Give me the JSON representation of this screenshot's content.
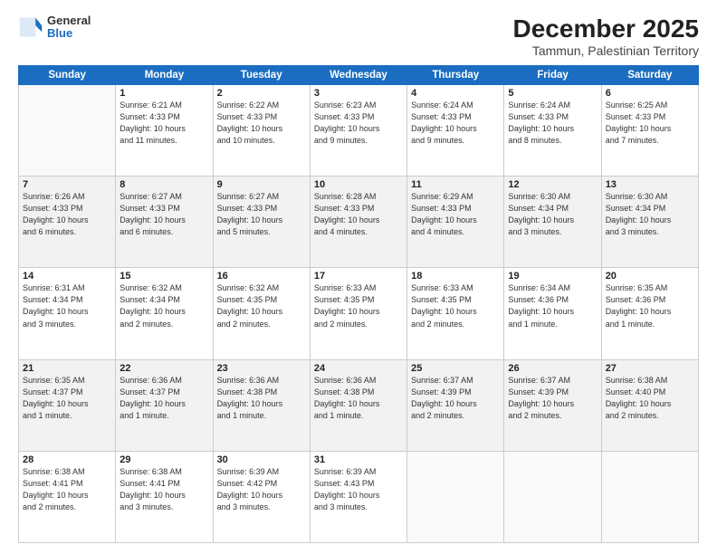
{
  "logo": {
    "general": "General",
    "blue": "Blue"
  },
  "title": "December 2025",
  "subtitle": "Tammun, Palestinian Territory",
  "weekdays": [
    "Sunday",
    "Monday",
    "Tuesday",
    "Wednesday",
    "Thursday",
    "Friday",
    "Saturday"
  ],
  "weeks": [
    [
      {
        "num": "",
        "info": ""
      },
      {
        "num": "1",
        "info": "Sunrise: 6:21 AM\nSunset: 4:33 PM\nDaylight: 10 hours\nand 11 minutes."
      },
      {
        "num": "2",
        "info": "Sunrise: 6:22 AM\nSunset: 4:33 PM\nDaylight: 10 hours\nand 10 minutes."
      },
      {
        "num": "3",
        "info": "Sunrise: 6:23 AM\nSunset: 4:33 PM\nDaylight: 10 hours\nand 9 minutes."
      },
      {
        "num": "4",
        "info": "Sunrise: 6:24 AM\nSunset: 4:33 PM\nDaylight: 10 hours\nand 9 minutes."
      },
      {
        "num": "5",
        "info": "Sunrise: 6:24 AM\nSunset: 4:33 PM\nDaylight: 10 hours\nand 8 minutes."
      },
      {
        "num": "6",
        "info": "Sunrise: 6:25 AM\nSunset: 4:33 PM\nDaylight: 10 hours\nand 7 minutes."
      }
    ],
    [
      {
        "num": "7",
        "info": "Sunrise: 6:26 AM\nSunset: 4:33 PM\nDaylight: 10 hours\nand 6 minutes."
      },
      {
        "num": "8",
        "info": "Sunrise: 6:27 AM\nSunset: 4:33 PM\nDaylight: 10 hours\nand 6 minutes."
      },
      {
        "num": "9",
        "info": "Sunrise: 6:27 AM\nSunset: 4:33 PM\nDaylight: 10 hours\nand 5 minutes."
      },
      {
        "num": "10",
        "info": "Sunrise: 6:28 AM\nSunset: 4:33 PM\nDaylight: 10 hours\nand 4 minutes."
      },
      {
        "num": "11",
        "info": "Sunrise: 6:29 AM\nSunset: 4:33 PM\nDaylight: 10 hours\nand 4 minutes."
      },
      {
        "num": "12",
        "info": "Sunrise: 6:30 AM\nSunset: 4:34 PM\nDaylight: 10 hours\nand 3 minutes."
      },
      {
        "num": "13",
        "info": "Sunrise: 6:30 AM\nSunset: 4:34 PM\nDaylight: 10 hours\nand 3 minutes."
      }
    ],
    [
      {
        "num": "14",
        "info": "Sunrise: 6:31 AM\nSunset: 4:34 PM\nDaylight: 10 hours\nand 3 minutes."
      },
      {
        "num": "15",
        "info": "Sunrise: 6:32 AM\nSunset: 4:34 PM\nDaylight: 10 hours\nand 2 minutes."
      },
      {
        "num": "16",
        "info": "Sunrise: 6:32 AM\nSunset: 4:35 PM\nDaylight: 10 hours\nand 2 minutes."
      },
      {
        "num": "17",
        "info": "Sunrise: 6:33 AM\nSunset: 4:35 PM\nDaylight: 10 hours\nand 2 minutes."
      },
      {
        "num": "18",
        "info": "Sunrise: 6:33 AM\nSunset: 4:35 PM\nDaylight: 10 hours\nand 2 minutes."
      },
      {
        "num": "19",
        "info": "Sunrise: 6:34 AM\nSunset: 4:36 PM\nDaylight: 10 hours\nand 1 minute."
      },
      {
        "num": "20",
        "info": "Sunrise: 6:35 AM\nSunset: 4:36 PM\nDaylight: 10 hours\nand 1 minute."
      }
    ],
    [
      {
        "num": "21",
        "info": "Sunrise: 6:35 AM\nSunset: 4:37 PM\nDaylight: 10 hours\nand 1 minute."
      },
      {
        "num": "22",
        "info": "Sunrise: 6:36 AM\nSunset: 4:37 PM\nDaylight: 10 hours\nand 1 minute."
      },
      {
        "num": "23",
        "info": "Sunrise: 6:36 AM\nSunset: 4:38 PM\nDaylight: 10 hours\nand 1 minute."
      },
      {
        "num": "24",
        "info": "Sunrise: 6:36 AM\nSunset: 4:38 PM\nDaylight: 10 hours\nand 1 minute."
      },
      {
        "num": "25",
        "info": "Sunrise: 6:37 AM\nSunset: 4:39 PM\nDaylight: 10 hours\nand 2 minutes."
      },
      {
        "num": "26",
        "info": "Sunrise: 6:37 AM\nSunset: 4:39 PM\nDaylight: 10 hours\nand 2 minutes."
      },
      {
        "num": "27",
        "info": "Sunrise: 6:38 AM\nSunset: 4:40 PM\nDaylight: 10 hours\nand 2 minutes."
      }
    ],
    [
      {
        "num": "28",
        "info": "Sunrise: 6:38 AM\nSunset: 4:41 PM\nDaylight: 10 hours\nand 2 minutes."
      },
      {
        "num": "29",
        "info": "Sunrise: 6:38 AM\nSunset: 4:41 PM\nDaylight: 10 hours\nand 3 minutes."
      },
      {
        "num": "30",
        "info": "Sunrise: 6:39 AM\nSunset: 4:42 PM\nDaylight: 10 hours\nand 3 minutes."
      },
      {
        "num": "31",
        "info": "Sunrise: 6:39 AM\nSunset: 4:43 PM\nDaylight: 10 hours\nand 3 minutes."
      },
      {
        "num": "",
        "info": ""
      },
      {
        "num": "",
        "info": ""
      },
      {
        "num": "",
        "info": ""
      }
    ]
  ]
}
